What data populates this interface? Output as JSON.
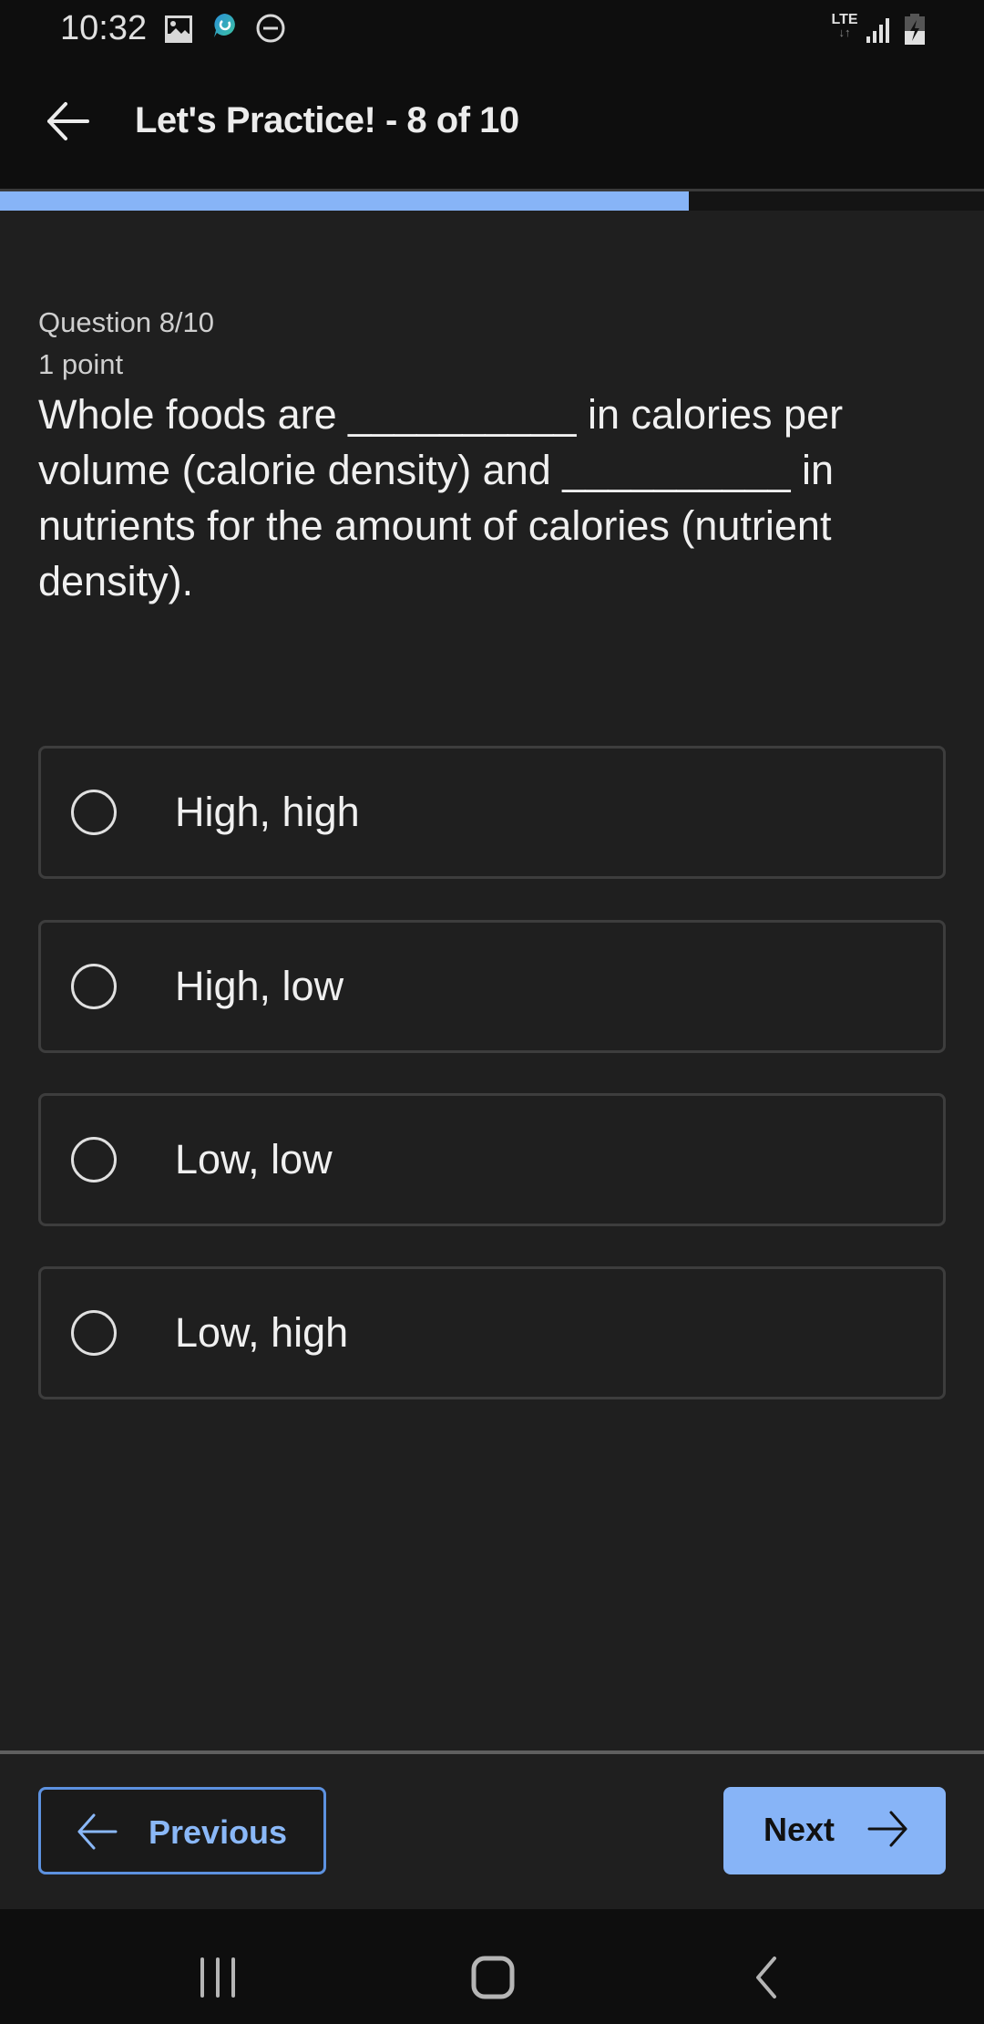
{
  "status_bar": {
    "time": "10:32",
    "left_icons": [
      "gallery-icon",
      "chat-app-icon",
      "do-not-disturb-icon"
    ],
    "network_label": "LTE",
    "right_icons": [
      "lte-data-icon",
      "signal-icon",
      "battery-charging-icon"
    ]
  },
  "app_bar": {
    "back_icon": "arrow-left-icon",
    "title": "Let's Practice! - 8 of 10"
  },
  "progress": {
    "current": 8,
    "total": 10,
    "fraction": 0.7,
    "color": "#87b4f7"
  },
  "question": {
    "counter": "Question 8/10",
    "points": "1 point",
    "lines": [
      "Whole foods are __________ in calories per",
      "volume (calorie density) and __________ in",
      "nutrients for the amount of calories (nutrient",
      "density)."
    ]
  },
  "options": [
    {
      "label": "High, high",
      "selected": false
    },
    {
      "label": "High, low",
      "selected": false
    },
    {
      "label": "Low, low",
      "selected": false
    },
    {
      "label": "Low, high",
      "selected": false
    }
  ],
  "footer": {
    "previous_label": "Previous",
    "next_label": "Next",
    "accent": "#87b4f7"
  },
  "nav_bar": {
    "icons": [
      "recent-apps-icon",
      "home-icon",
      "back-icon"
    ]
  }
}
